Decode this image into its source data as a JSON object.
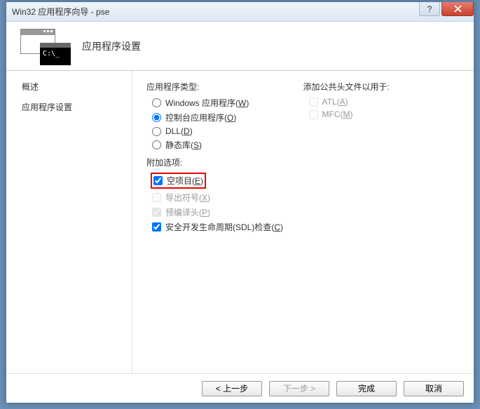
{
  "titlebar": {
    "title": "Win32 应用程序向导 - pse"
  },
  "header": {
    "title": "应用程序设置",
    "console_prompt": "C:\\_"
  },
  "sidebar": {
    "items": [
      {
        "label": "概述"
      },
      {
        "label": "应用程序设置"
      }
    ]
  },
  "content": {
    "app_type_label": "应用程序类型:",
    "app_types": [
      {
        "label": "Windows 应用程序(",
        "key": "W",
        "suffix": ")",
        "checked": false
      },
      {
        "label": "控制台应用程序(",
        "key": "O",
        "suffix": ")",
        "checked": true
      },
      {
        "label": "DLL(",
        "key": "D",
        "suffix": ")",
        "checked": false
      },
      {
        "label": "静态库(",
        "key": "S",
        "suffix": ")",
        "checked": false
      }
    ],
    "additional_label": "附加选项:",
    "additional": [
      {
        "label": "空项目(",
        "key": "E",
        "suffix": ")",
        "checked": true,
        "disabled": false,
        "highlight": true
      },
      {
        "label": "导出符号(",
        "key": "X",
        "suffix": ")",
        "checked": false,
        "disabled": true
      },
      {
        "label": "预编译头(",
        "key": "P",
        "suffix": ")",
        "checked": true,
        "disabled": true
      },
      {
        "label": "安全开发生命周期(SDL)检查(",
        "key": "C",
        "suffix": ")",
        "checked": true,
        "disabled": false
      }
    ],
    "headers_label": "添加公共头文件以用于:",
    "headers": [
      {
        "label": "ATL(",
        "key": "A",
        "suffix": ")",
        "checked": false,
        "disabled": true
      },
      {
        "label": "MFC(",
        "key": "M",
        "suffix": ")",
        "checked": false,
        "disabled": true
      }
    ]
  },
  "footer": {
    "prev": "< 上一步",
    "next": "下一步 >",
    "finish": "完成",
    "cancel": "取消"
  }
}
